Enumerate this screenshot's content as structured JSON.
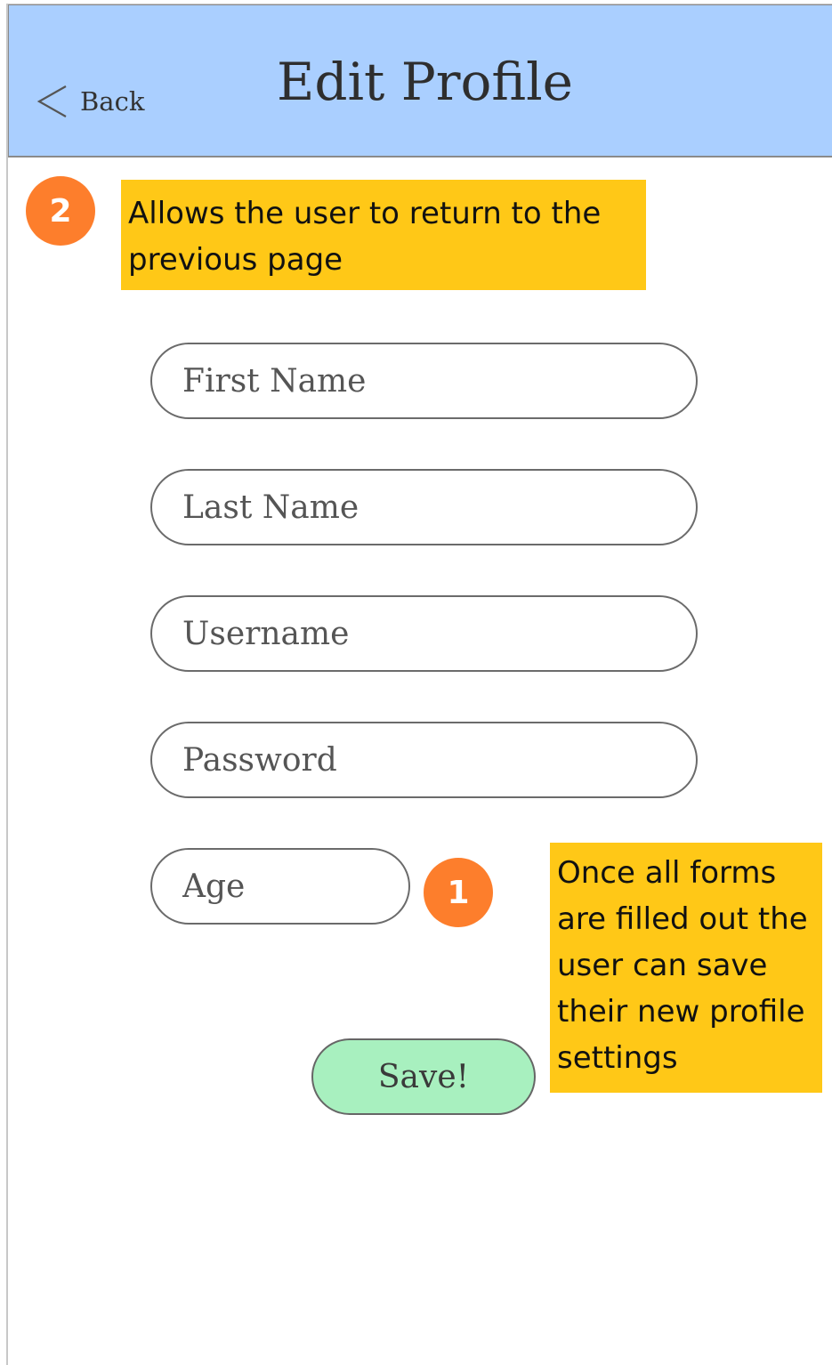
{
  "header": {
    "back_label": "Back",
    "title": "Edit Profile",
    "background": "#aacfff"
  },
  "annotations": [
    {
      "number": "2",
      "text": "Allows the user to return to the previous page"
    },
    {
      "number": "1",
      "text": "Once all forms are filled out the user can save their new profile settings"
    }
  ],
  "form": {
    "fields": [
      {
        "placeholder": "First Name",
        "value": ""
      },
      {
        "placeholder": "Last Name",
        "value": ""
      },
      {
        "placeholder": "Username",
        "value": ""
      },
      {
        "placeholder": "Password",
        "value": ""
      },
      {
        "placeholder": "Age",
        "value": ""
      }
    ],
    "save_label": "Save!"
  },
  "colors": {
    "badge": "#fd7e2c",
    "note": "#ffc817",
    "save_button": "#a8f0bf"
  },
  "icons": {
    "back": "chevron-left-icon"
  }
}
